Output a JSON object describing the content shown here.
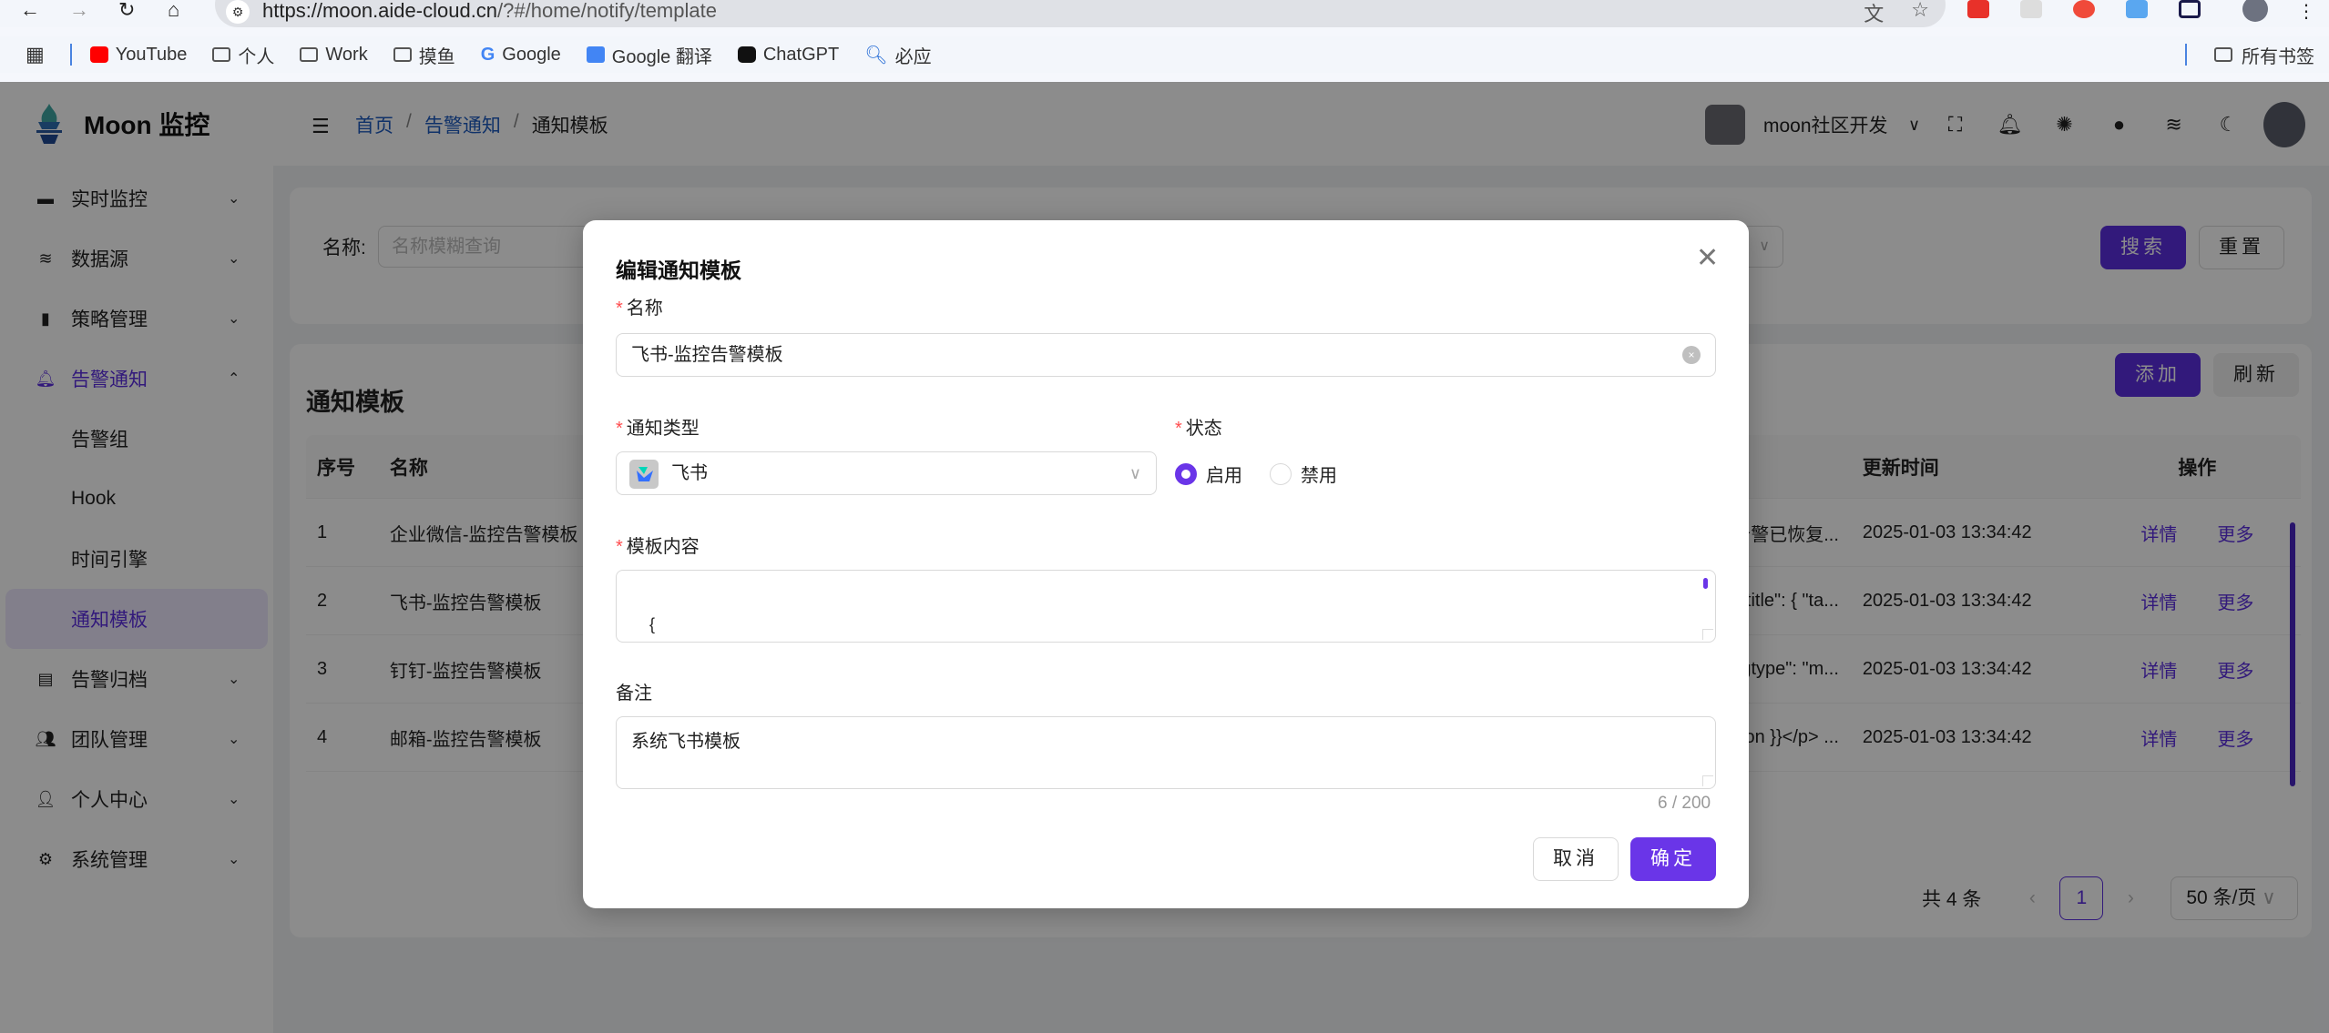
{
  "browser": {
    "url_host": "https://moon.aide-cloud.cn",
    "url_path": "/?#/home/notify/template",
    "bookmarks": [
      {
        "label": "YouTube",
        "icon": "youtube-icon"
      },
      {
        "label": "个人",
        "icon": "folder-icon"
      },
      {
        "label": "Work",
        "icon": "folder-icon"
      },
      {
        "label": "摸鱼",
        "icon": "folder-icon"
      },
      {
        "label": "Google",
        "icon": "google-icon"
      },
      {
        "label": "Google 翻译",
        "icon": "google-translate-icon"
      },
      {
        "label": "ChatGPT",
        "icon": "chatgpt-icon"
      },
      {
        "label": "必应",
        "icon": "bing-search-icon"
      }
    ],
    "all_bookmarks": "所有书签"
  },
  "app": {
    "logo_text": "Moon 监控",
    "sidebar": {
      "items": [
        {
          "label": "实时监控",
          "icon": "monitor-icon"
        },
        {
          "label": "数据源",
          "icon": "layers-icon"
        },
        {
          "label": "策略管理",
          "icon": "strategy-icon"
        },
        {
          "label": "告警通知",
          "icon": "bell-icon",
          "expanded": true
        },
        {
          "label": "告警归档",
          "icon": "archive-icon"
        },
        {
          "label": "团队管理",
          "icon": "team-icon"
        },
        {
          "label": "个人中心",
          "icon": "user-icon"
        },
        {
          "label": "系统管理",
          "icon": "gear-icon"
        }
      ],
      "submenu": [
        "告警组",
        "Hook",
        "时间引擎",
        "通知模板"
      ],
      "selected": "通知模板"
    },
    "header": {
      "breadcrumb": [
        "首页",
        "告警通知",
        "通知模板"
      ],
      "team_name": "moon社区开发"
    },
    "search": {
      "name_label": "名称:",
      "name_placeholder": "名称模糊查询",
      "search_button": "搜索",
      "reset_button": "重置"
    },
    "table": {
      "title": "通知模板",
      "add_button": "添加",
      "refresh_button": "刷新",
      "columns": [
        "序号",
        "名称",
        "更新时间",
        "操作"
      ],
      "rows": [
        {
          "index": "1",
          "name": "企业微信-监控告警模板",
          "content_snippet": "告警已恢复...",
          "updated": "2025-01-03 13:34:42"
        },
        {
          "index": "2",
          "name": "飞书-监控告警模板",
          "content_snippet": "\"title\": { \"ta...",
          "updated": "2025-01-03 13:34:42"
        },
        {
          "index": "3",
          "name": "钉钉-监控告警模板",
          "content_snippet": "sgtype\": \"m...",
          "updated": "2025-01-03 13:34:42"
        },
        {
          "index": "4",
          "name": "邮箱-监控告警模板",
          "content_snippet": "ion }}</p> ...",
          "updated": "2025-01-03 13:34:42"
        }
      ],
      "op_detail": "详情",
      "op_more": "更多"
    },
    "pagination": {
      "total": "共 4 条",
      "current_page": "1",
      "page_size": "50 条/页"
    }
  },
  "modal": {
    "title": "编辑通知模板",
    "name_label": "名称",
    "name_value": "飞书-监控告警模板",
    "type_label": "通知类型",
    "type_value": "飞书",
    "status_label": "状态",
    "status_options": [
      "启用",
      "禁用"
    ],
    "status_selected": "启用",
    "content_label": "模板内容",
    "content_value": "{\n  \"msg_type\": \"interactive\",",
    "remark_label": "备注",
    "remark_value": "系统飞书模板",
    "remark_counter": "6 / 200",
    "cancel_button": "取消",
    "ok_button": "确定"
  },
  "colors": {
    "primary": "#5b2ee0",
    "link": "#1e5bbf",
    "required": "#ff4d4f"
  }
}
